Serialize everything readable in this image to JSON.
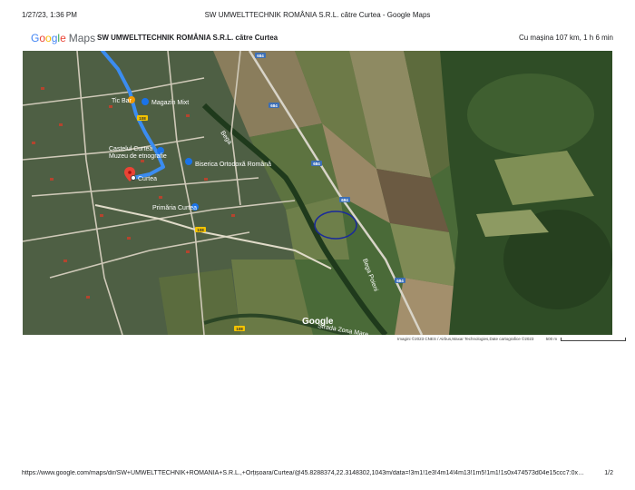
{
  "print_header": {
    "datetime": "1/27/23, 1:36 PM",
    "page_title": "SW UMWELTTECHNIK ROMÂNIA S.R.L. către Curtea - Google Maps"
  },
  "maps_header": {
    "logo_google": "Google",
    "logo_maps": "Maps",
    "route_title": "SW UMWELTTECHNIK ROMÂNIA S.R.L. către Curtea",
    "route_summary": "Cu mașina 107 km, 1 h 6 min"
  },
  "map": {
    "labels": {
      "bar": "Tic Bar",
      "shop": "Magazin Mixt",
      "castle": "Castelul Curtea\nMuzeu de etnografie",
      "destination": "Curtea",
      "church": "Biserica Ortodoxă Română",
      "city_hall": "Primăria Curtea",
      "stream1": "Bega",
      "stream2": "Bega Poieni",
      "road_lower": "Strada Zona Mare"
    },
    "road_shields": [
      "684",
      "684",
      "684",
      "684",
      "684",
      "108",
      "108",
      "108"
    ],
    "watermark": "Google",
    "colors": {
      "route": "#3b8cf0",
      "destination_pin": "#ea4335",
      "highlight_circle": "#1a2a9a"
    }
  },
  "attribution": {
    "imagery": "Imagini ©2023 CNES / Airbus,Maxar Technologies,Date cartografice ©2023",
    "scale": "500 m"
  },
  "print_footer": {
    "url": "https://www.google.com/maps/dir/SW+UMWELTTECHNIK+ROMÂNIA+S.R.L.,+Orțișoara/Curtea/@45.8288374,22.3148302,1043m/data=!3m1!1e3!4m14!4m13!1m5!1m1!1s0x474573d04e15ccc7:0x41…",
    "page": "1/2"
  }
}
